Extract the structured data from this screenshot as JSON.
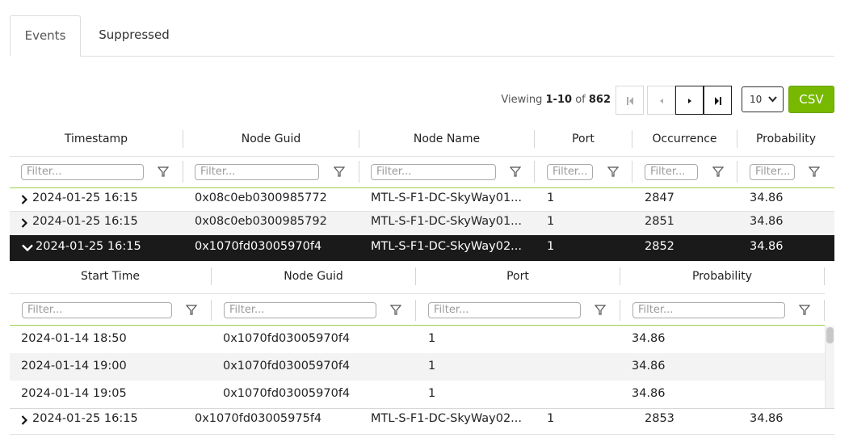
{
  "tabs": [
    {
      "label": "Events",
      "active": true
    },
    {
      "label": "Suppressed",
      "active": false
    }
  ],
  "pagination": {
    "viewing_prefix": "Viewing ",
    "viewing_range": "1-10",
    "viewing_of": " of ",
    "viewing_total": "862",
    "page_size": "10",
    "csv_label": "CSV",
    "buttons": [
      "first-page-icon",
      "prev-page-icon",
      "next-page-icon",
      "last-page-icon"
    ]
  },
  "filter_placeholder": "Filter...",
  "colors": {
    "accent": "#76b900",
    "selected_row": "#1a1a1a",
    "separator": "#d5d5d5"
  },
  "table": {
    "columns": [
      "Timestamp",
      "Node Guid",
      "Node Name",
      "Port",
      "Occurrence",
      "Probability"
    ],
    "rows": [
      {
        "timestamp": "2024-01-25 16:15",
        "node_guid": "0x08c0eb0300985772",
        "node_name": "MTL-S-F1-DC-SkyWay01...",
        "port": "1",
        "occurrence": "2847",
        "probability": "34.86",
        "expanded": false
      },
      {
        "timestamp": "2024-01-25 16:15",
        "node_guid": "0x08c0eb0300985792",
        "node_name": "MTL-S-F1-DC-SkyWay01...",
        "port": "1",
        "occurrence": "2851",
        "probability": "34.86",
        "expanded": false
      },
      {
        "timestamp": "2024-01-25 16:15",
        "node_guid": "0x1070fd03005970f4",
        "node_name": "MTL-S-F1-DC-SkyWay02...",
        "port": "1",
        "occurrence": "2852",
        "probability": "34.86",
        "expanded": true
      },
      {
        "timestamp": "2024-01-25 16:15",
        "node_guid": "0x1070fd03005975f4",
        "node_name": "MTL-S-F1-DC-SkyWay02...",
        "port": "1",
        "occurrence": "2853",
        "probability": "34.86",
        "expanded": false
      }
    ]
  },
  "subtable": {
    "columns": [
      "Start Time",
      "Node Guid",
      "Port",
      "Probability"
    ],
    "rows": [
      {
        "start_time": "2024-01-14 18:50",
        "node_guid": "0x1070fd03005970f4",
        "port": "1",
        "probability": "34.86"
      },
      {
        "start_time": "2024-01-14 19:00",
        "node_guid": "0x1070fd03005970f4",
        "port": "1",
        "probability": "34.86"
      },
      {
        "start_time": "2024-01-14 19:05",
        "node_guid": "0x1070fd03005970f4",
        "port": "1",
        "probability": "34.86"
      }
    ]
  }
}
